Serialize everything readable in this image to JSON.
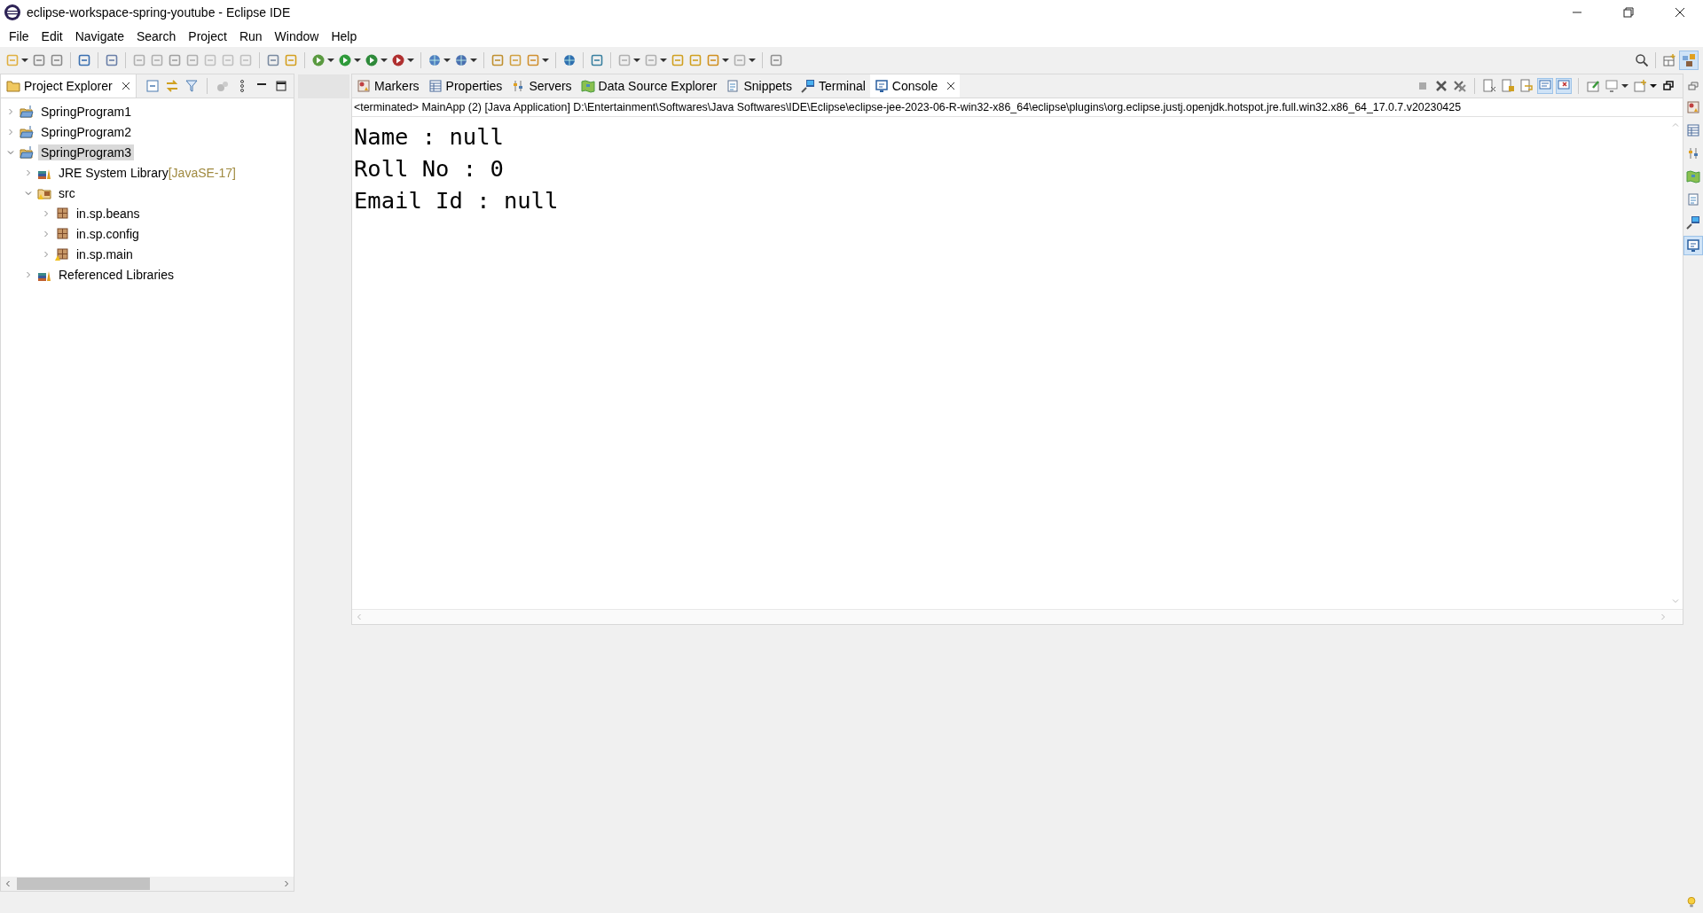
{
  "window": {
    "title": "eclipse-workspace-spring-youtube - Eclipse IDE"
  },
  "menu": [
    "File",
    "Edit",
    "Navigate",
    "Search",
    "Project",
    "Run",
    "Window",
    "Help"
  ],
  "project_explorer": {
    "title": "Project Explorer",
    "tree": [
      {
        "label": "SpringProgram1",
        "kind": "project",
        "expanded": false,
        "selected": false
      },
      {
        "label": "SpringProgram2",
        "kind": "project",
        "expanded": false,
        "selected": false
      },
      {
        "label": "SpringProgram3",
        "kind": "project",
        "expanded": true,
        "selected": true,
        "children": [
          {
            "label": "JRE System Library",
            "suffix": "[JavaSE-17]",
            "kind": "library",
            "expanded": false,
            "selected": false
          },
          {
            "label": "src",
            "kind": "source",
            "expanded": true,
            "selected": false,
            "children": [
              {
                "label": "in.sp.beans",
                "kind": "package",
                "expanded": false,
                "selected": false
              },
              {
                "label": "in.sp.config",
                "kind": "package",
                "expanded": false,
                "selected": false
              },
              {
                "label": "in.sp.main",
                "kind": "package-warning",
                "expanded": false,
                "selected": false
              }
            ]
          },
          {
            "label": "Referenced Libraries",
            "kind": "library",
            "expanded": false,
            "selected": false
          }
        ]
      }
    ]
  },
  "view_tabs": [
    {
      "label": "Markers",
      "kind": "markers",
      "selected": false
    },
    {
      "label": "Properties",
      "kind": "properties",
      "selected": false
    },
    {
      "label": "Servers",
      "kind": "servers",
      "selected": false
    },
    {
      "label": "Data Source Explorer",
      "kind": "datasource",
      "selected": false
    },
    {
      "label": "Snippets",
      "kind": "snippets",
      "selected": false
    },
    {
      "label": "Terminal",
      "kind": "terminal",
      "selected": false
    },
    {
      "label": "Console",
      "kind": "console",
      "selected": true
    }
  ],
  "console": {
    "status": "<terminated> MainApp (2) [Java Application] D:\\Entertainment\\Softwares\\Java Softwares\\IDE\\Eclipse\\eclipse-jee-2023-06-R-win32-x86_64\\eclipse\\plugins\\org.eclipse.justj.openjdk.hotspot.jre.full.win32.x86_64_17.0.7.v20230425",
    "lines": [
      "Name : null",
      "Roll No : 0",
      "Email Id : null"
    ]
  }
}
